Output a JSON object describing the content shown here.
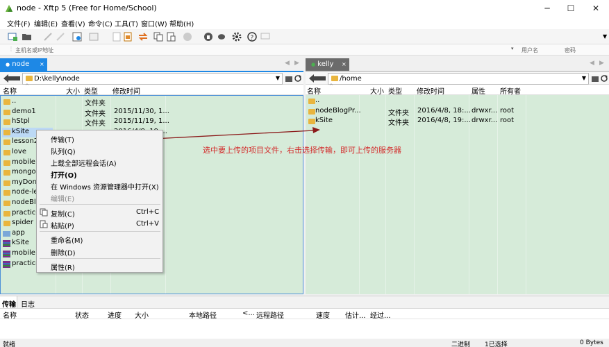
{
  "window": {
    "title": "node - Xftp 5 (Free for Home/School)"
  },
  "menu": [
    "文件(F)",
    "编辑(E)",
    "查看(V)",
    "命令(C)",
    "工具(T)",
    "窗口(W)",
    "帮助(H)"
  ],
  "address": {
    "host_placeholder": "主机名或IP地址",
    "user_placeholder": "用户名",
    "password_placeholder": "密码"
  },
  "left": {
    "tab": "node",
    "path": "D:\\kelly\\node",
    "columns": [
      "名称",
      "大小",
      "类型",
      "修改时间"
    ],
    "files": [
      {
        "name": "..",
        "size": "",
        "type": "文件夹",
        "date": ""
      },
      {
        "name": "demo1",
        "size": "",
        "type": "文件夹",
        "date": "2015/11/30, 1..."
      },
      {
        "name": "hStpl",
        "size": "",
        "type": "文件夹",
        "date": "2015/11/19, 1..."
      },
      {
        "name": "kSite",
        "size": "",
        "type": "文件夹",
        "date": "2016/4/8, 19:..."
      },
      {
        "name": "lesson2",
        "size": "",
        "type": "",
        "date": ""
      },
      {
        "name": "love",
        "size": "",
        "type": "",
        "date": ""
      },
      {
        "name": "mobile1",
        "size": "",
        "type": "",
        "date": ""
      },
      {
        "name": "mongod",
        "size": "",
        "type": "",
        "date": ""
      },
      {
        "name": "myDorm",
        "size": "",
        "type": "",
        "date": ""
      },
      {
        "name": "node-les",
        "size": "",
        "type": "",
        "date": ""
      },
      {
        "name": "nodeBlog",
        "size": "",
        "type": "",
        "date": ""
      },
      {
        "name": "practice",
        "size": "",
        "type": "",
        "date": ""
      },
      {
        "name": "spider",
        "size": "",
        "type": "",
        "date": ""
      },
      {
        "name": "app",
        "size": "",
        "type": "",
        "date": ""
      },
      {
        "name": "kSite",
        "size": "",
        "type": "",
        "date": ""
      },
      {
        "name": "mobile1",
        "size": "",
        "type": "",
        "date": ""
      },
      {
        "name": "practice",
        "size": "",
        "type": "",
        "date": ""
      }
    ]
  },
  "right": {
    "tab": "kelly",
    "path": "/home",
    "columns": [
      "名称",
      "大小",
      "类型",
      "修改时间",
      "属性",
      "所有者"
    ],
    "files": [
      {
        "name": "..",
        "size": "",
        "type": "",
        "date": "",
        "attr": "",
        "owner": ""
      },
      {
        "name": "nodeBlogPr...",
        "size": "",
        "type": "文件夹",
        "date": "2016/4/8, 18:...",
        "attr": "drwxr...",
        "owner": "root"
      },
      {
        "name": "kSite",
        "size": "",
        "type": "文件夹",
        "date": "2016/4/8, 19:...",
        "attr": "drwxr...",
        "owner": "root"
      }
    ]
  },
  "context_menu": [
    {
      "label": "传输(T)",
      "shortcut": ""
    },
    {
      "label": "队列(Q)",
      "shortcut": ""
    },
    {
      "label": "上载全部远程会话(A)",
      "shortcut": ""
    },
    {
      "label": "打开(O)",
      "shortcut": ""
    },
    {
      "label": "在 Windows 资源管理器中打开(X)",
      "shortcut": ""
    },
    {
      "label": "编辑(E)",
      "shortcut": ""
    },
    {
      "label": "复制(C)",
      "shortcut": "Ctrl+C"
    },
    {
      "label": "粘贴(P)",
      "shortcut": "Ctrl+V"
    },
    {
      "label": "重命名(M)",
      "shortcut": ""
    },
    {
      "label": "删除(D)",
      "shortcut": ""
    },
    {
      "label": "属性(R)",
      "shortcut": ""
    }
  ],
  "annotation": "选中要上传的项目文件，右击选择传输，即可上传的服务器",
  "bottom_tabs": [
    "传输",
    "日志"
  ],
  "transfer_columns": [
    "名称",
    "状态",
    "进度",
    "大小",
    "本地路径",
    "<...",
    "远程路径",
    "速度",
    "估计...",
    "经过..."
  ],
  "status": {
    "left": "就绪",
    "mode": "二进制",
    "selected": "1已选择",
    "bytes": "0 Bytes"
  },
  "colors": {
    "tab_active": "#1e88e5",
    "tab_remote": "#6b6b6b",
    "pane_bg": "#d6ebd9",
    "annotation": "#d32c2c",
    "arrow": "#8b1a1a"
  }
}
